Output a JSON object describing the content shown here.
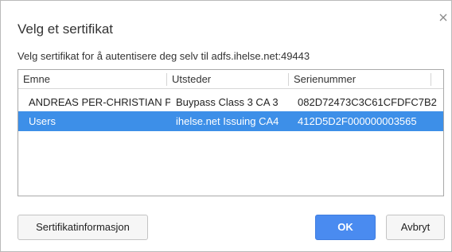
{
  "dialog": {
    "title": "Velg et sertifikat",
    "description": "Velg sertifikat for å autentisere deg selv til adfs.ihelse.net:49443",
    "close_icon": "close-icon"
  },
  "table": {
    "columns": [
      "Emne",
      "Utsteder",
      "Serienummer"
    ],
    "rows": [
      {
        "subject": "ANDREAS PER-CHRISTIAN P...",
        "issuer": "Buypass Class 3 CA 3",
        "serial": "082D72473C3C61CFDFC7B2",
        "selected": false
      },
      {
        "subject": "Users",
        "issuer": "ihelse.net Issuing CA4",
        "serial": "412D5D2F000000003565",
        "selected": true
      }
    ]
  },
  "buttons": {
    "cert_info": "Sertifikatinformasjon",
    "ok": "OK",
    "cancel": "Avbryt"
  },
  "colors": {
    "selection": "#3d8fe8",
    "primary_button": "#4a8bf0"
  }
}
